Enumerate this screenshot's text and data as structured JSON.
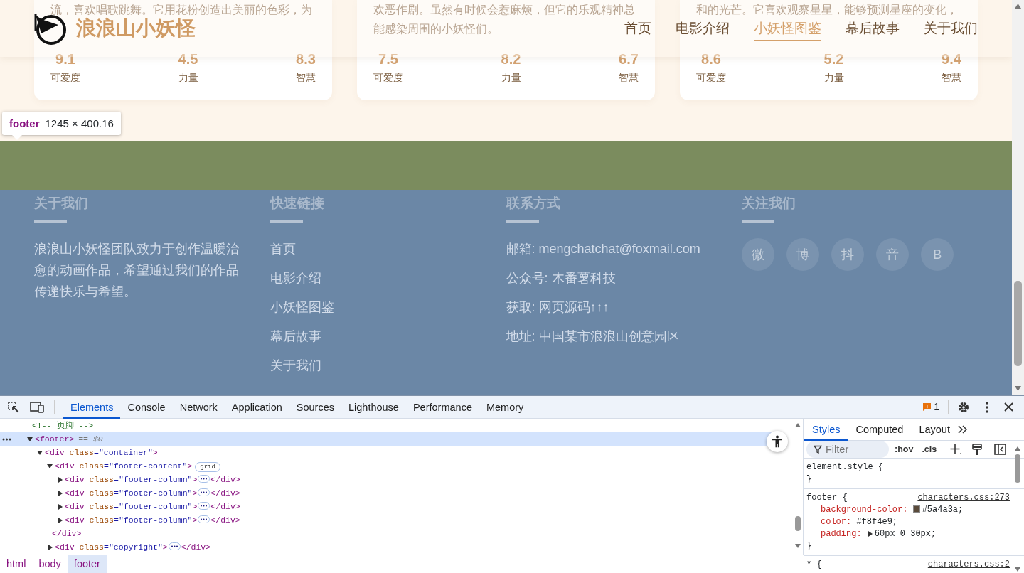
{
  "header": {
    "logo_text": "浪浪山小妖怪",
    "nav": [
      {
        "label": "首页",
        "selected": false
      },
      {
        "label": "电影介绍",
        "selected": false
      },
      {
        "label": "小妖怪图鉴",
        "selected": true
      },
      {
        "label": "幕后故事",
        "selected": false
      },
      {
        "label": "关于我们",
        "selected": false
      }
    ]
  },
  "cards": [
    {
      "faint_lines": [
        "流，喜欢唱歌跳舞。它用花粉创造出美丽的色彩，为"
      ],
      "stats": [
        {
          "value": "9.1",
          "label": "可爱度"
        },
        {
          "value": "4.5",
          "label": "力量"
        },
        {
          "value": "8.3",
          "label": "智慧"
        }
      ]
    },
    {
      "faint_lines": [
        "欢恶作剧。虽然有时候会惹麻烦，但它的乐观精神总",
        "能感染周围的小妖怪们。"
      ],
      "stats": [
        {
          "value": "7.5",
          "label": "可爱度"
        },
        {
          "value": "8.2",
          "label": "力量"
        },
        {
          "value": "6.7",
          "label": "智慧"
        }
      ]
    },
    {
      "faint_lines": [
        "和的光芒。它喜欢观察星星，能够预测星座的变化，"
      ],
      "stats": [
        {
          "value": "8.6",
          "label": "可爱度"
        },
        {
          "value": "5.2",
          "label": "力量"
        },
        {
          "value": "9.4",
          "label": "智慧"
        }
      ]
    }
  ],
  "inspector_tooltip": {
    "tag": "footer",
    "size": "1245 × 400.16"
  },
  "footer": {
    "columns": [
      {
        "kind": "text",
        "title": "关于我们",
        "text": "浪浪山小妖怪团队致力于创作温暖治愈的动画作品，希望通过我们的作品传递快乐与希望。"
      },
      {
        "kind": "links",
        "title": "快速链接",
        "items": [
          "首页",
          "电影介绍",
          "小妖怪图鉴",
          "幕后故事",
          "关于我们"
        ]
      },
      {
        "kind": "info",
        "title": "联系方式",
        "items": [
          "邮箱: mengchatchat@foxmail.com",
          "公众号: 木番薯科技",
          "获取: 网页源码↑↑↑",
          "地址: 中国某市浪浪山创意园区"
        ]
      },
      {
        "kind": "social",
        "title": "关注我们",
        "items": [
          "微",
          "博",
          "抖",
          "音",
          "B"
        ]
      }
    ]
  },
  "devtools": {
    "tabs": [
      {
        "label": "Elements",
        "selected": true
      },
      {
        "label": "Console",
        "selected": false
      },
      {
        "label": "Network",
        "selected": false
      },
      {
        "label": "Application",
        "selected": false
      },
      {
        "label": "Sources",
        "selected": false
      },
      {
        "label": "Lighthouse",
        "selected": false
      },
      {
        "label": "Performance",
        "selected": false
      },
      {
        "label": "Memory",
        "selected": false
      }
    ],
    "issues_count": "1",
    "dom_tree": [
      {
        "kind": "comment",
        "segments": [
          {
            "t": "<!-- 页脚 -->",
            "kind": "comment"
          }
        ]
      },
      {
        "kind": "element",
        "expanded": true,
        "selected": true,
        "segments": [
          {
            "t": "<footer>",
            "kind": "tag"
          }
        ],
        "note": "== $0",
        "children": [
          {
            "kind": "element",
            "expanded": true,
            "selected": false,
            "segments": [
              {
                "t": "<div ",
                "kind": "tag"
              },
              {
                "t": "class",
                "kind": "attr"
              },
              {
                "t": "=\"container\"",
                "kind": "val"
              },
              {
                "t": ">",
                "kind": "tag"
              }
            ],
            "children": [
              {
                "kind": "element",
                "expanded": true,
                "selected": false,
                "segments": [
                  {
                    "t": "<div ",
                    "kind": "tag"
                  },
                  {
                    "t": "class",
                    "kind": "attr"
                  },
                  {
                    "t": "=\"footer-content\"",
                    "kind": "val"
                  },
                  {
                    "t": ">",
                    "kind": "tag"
                  }
                ],
                "badge": "grid",
                "children": [
                  {
                    "kind": "element",
                    "expanded": false,
                    "selected": false,
                    "segments": [
                      {
                        "t": "<div ",
                        "kind": "tag"
                      },
                      {
                        "t": "class",
                        "kind": "attr"
                      },
                      {
                        "t": "=\"footer-column\"",
                        "kind": "val"
                      },
                      {
                        "t": ">",
                        "kind": "tag"
                      }
                    ],
                    "closing": "</div>"
                  },
                  {
                    "kind": "element",
                    "expanded": false,
                    "selected": false,
                    "segments": [
                      {
                        "t": "<div ",
                        "kind": "tag"
                      },
                      {
                        "t": "class",
                        "kind": "attr"
                      },
                      {
                        "t": "=\"footer-column\"",
                        "kind": "val"
                      },
                      {
                        "t": ">",
                        "kind": "tag"
                      }
                    ],
                    "closing": "</div>"
                  },
                  {
                    "kind": "element",
                    "expanded": false,
                    "selected": false,
                    "segments": [
                      {
                        "t": "<div ",
                        "kind": "tag"
                      },
                      {
                        "t": "class",
                        "kind": "attr"
                      },
                      {
                        "t": "=\"footer-column\"",
                        "kind": "val"
                      },
                      {
                        "t": ">",
                        "kind": "tag"
                      }
                    ],
                    "closing": "</div>"
                  },
                  {
                    "kind": "element",
                    "expanded": false,
                    "selected": false,
                    "segments": [
                      {
                        "t": "<div ",
                        "kind": "tag"
                      },
                      {
                        "t": "class",
                        "kind": "attr"
                      },
                      {
                        "t": "=\"footer-column\"",
                        "kind": "val"
                      },
                      {
                        "t": ">",
                        "kind": "tag"
                      }
                    ],
                    "closing": "</div>"
                  },
                  {
                    "kind": "close",
                    "segments": [
                      {
                        "t": "</div>",
                        "kind": "tag"
                      }
                    ]
                  }
                ]
              },
              {
                "kind": "element",
                "expanded": false,
                "selected": false,
                "segments": [
                  {
                    "t": "<div ",
                    "kind": "tag"
                  },
                  {
                    "t": "class",
                    "kind": "attr"
                  },
                  {
                    "t": "=\"copyright\"",
                    "kind": "val"
                  },
                  {
                    "t": ">",
                    "kind": "tag"
                  }
                ],
                "closing": "</div>"
              }
            ]
          }
        ]
      }
    ],
    "styles_panel": {
      "tabs": [
        {
          "label": "Styles",
          "selected": true
        },
        {
          "label": "Computed",
          "selected": false
        },
        {
          "label": "Layout",
          "selected": false
        }
      ],
      "filter_placeholder": "Filter",
      "buttons": [
        ":hov",
        ".cls"
      ],
      "rules": [
        {
          "selector": "element.style {",
          "end": "}"
        },
        {
          "selector": "footer {",
          "source": "characters.css:273",
          "props": [
            {
              "name": "background-color:",
              "value": "#5a4a3a;",
              "color": "#5a4a3a"
            },
            {
              "name": "color:",
              "value": "#f8f4e9;"
            },
            {
              "name": "padding:",
              "value": "60px 0 30px;",
              "expandable": true
            }
          ],
          "end": "}"
        },
        {
          "selector": "* {",
          "source": "characters.css:2"
        }
      ]
    },
    "breadcrumbs": [
      {
        "label": "html",
        "selected": false
      },
      {
        "label": "body",
        "selected": false
      },
      {
        "label": "footer",
        "selected": true
      }
    ]
  }
}
